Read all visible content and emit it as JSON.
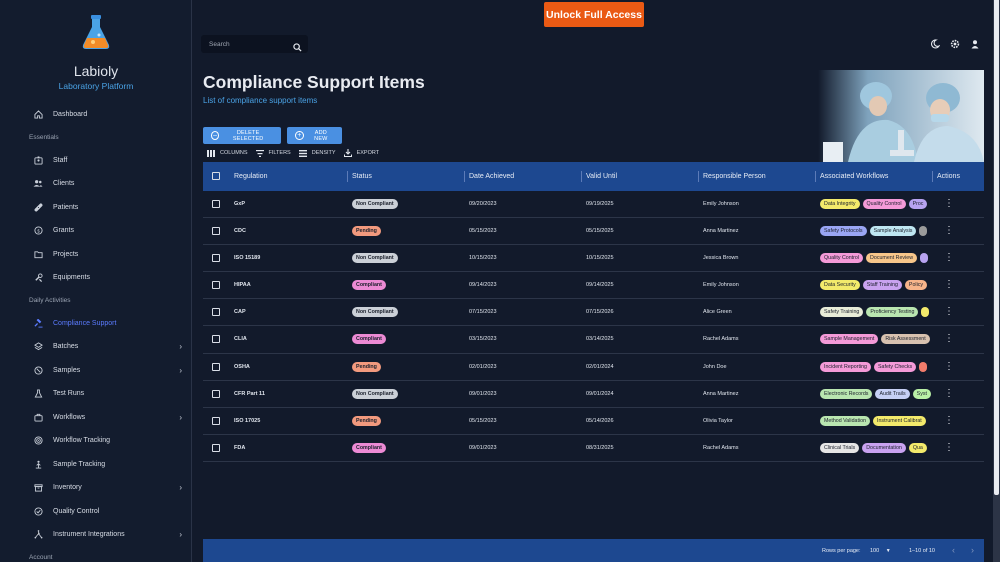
{
  "sidebar": {
    "brand_name": "Labioly",
    "brand_sub": "Laboratory Platform",
    "items": [
      {
        "type": "item",
        "label": "Dashboard",
        "icon": "home-icon"
      },
      {
        "type": "section",
        "label": "Essentials"
      },
      {
        "type": "item",
        "label": "Staff",
        "icon": "badge-icon"
      },
      {
        "type": "item",
        "label": "Clients",
        "icon": "users-icon"
      },
      {
        "type": "item",
        "label": "Patients",
        "icon": "bandage-icon"
      },
      {
        "type": "item",
        "label": "Grants",
        "icon": "coin-icon"
      },
      {
        "type": "item",
        "label": "Projects",
        "icon": "folder-icon"
      },
      {
        "type": "item",
        "label": "Equipments",
        "icon": "tools-icon"
      },
      {
        "type": "section",
        "label": "Daily Activities"
      },
      {
        "type": "item",
        "label": "Compliance Support",
        "icon": "gavel-icon",
        "active": true
      },
      {
        "type": "item",
        "label": "Batches",
        "icon": "layers-icon",
        "chevron": true
      },
      {
        "type": "item",
        "label": "Samples",
        "icon": "vial-icon",
        "chevron": true
      },
      {
        "type": "item",
        "label": "Test Runs",
        "icon": "flask-icon"
      },
      {
        "type": "item",
        "label": "Workflows",
        "icon": "briefcase-icon",
        "chevron": true
      },
      {
        "type": "item",
        "label": "Workflow Tracking",
        "icon": "target-icon"
      },
      {
        "type": "item",
        "label": "Sample Tracking",
        "icon": "tracking-icon"
      },
      {
        "type": "item",
        "label": "Inventory",
        "icon": "inventory-icon",
        "chevron": true
      },
      {
        "type": "item",
        "label": "Quality Control",
        "icon": "check-circle-icon"
      },
      {
        "type": "item",
        "label": "Instrument Integrations",
        "icon": "hub-icon",
        "chevron": true
      },
      {
        "type": "section",
        "label": "Account"
      }
    ]
  },
  "topbar": {
    "unlock_label": "Unlock Full Access",
    "search_placeholder": "Search"
  },
  "page": {
    "title": "Compliance Support Items",
    "subtitle": "List of compliance support items"
  },
  "toolbar": {
    "delete_label": "DELETE SELECTED",
    "add_label": "ADD NEW",
    "columns_label": "COLUMNS",
    "filters_label": "FILTERS",
    "density_label": "DENSITY",
    "export_label": "EXPORT"
  },
  "table": {
    "headers": {
      "regulation": "Regulation",
      "status": "Status",
      "date": "Date Achieved",
      "valid": "Valid Until",
      "person": "Responsible Person",
      "workflows": "Associated Workflows",
      "actions": "Actions"
    },
    "rows": [
      {
        "regulation": "GxP",
        "status": "Non Compliant",
        "status_kind": "non",
        "date": "09/20/2023",
        "valid": "09/19/2025",
        "person": "Emily Johnson",
        "workflows": [
          {
            "label": "Data Integrity",
            "color": "#f3ea6b"
          },
          {
            "label": "Quality Control",
            "color": "#f49ad8"
          },
          {
            "label": "Proc",
            "color": "#b7a3f0"
          }
        ]
      },
      {
        "regulation": "CDC",
        "status": "Pending",
        "status_kind": "pend",
        "date": "05/15/2023",
        "valid": "05/15/2025",
        "person": "Anna Martinez",
        "workflows": [
          {
            "label": "Safety Protocols",
            "color": "#9aa6f4"
          },
          {
            "label": "Sample Analysis",
            "color": "#bfe7f2"
          },
          {
            "label": "",
            "color": "#9b9b9b"
          }
        ]
      },
      {
        "regulation": "ISO 15189",
        "status": "Non Compliant",
        "status_kind": "non",
        "date": "10/15/2023",
        "valid": "10/15/2025",
        "person": "Jessica Brown",
        "workflows": [
          {
            "label": "Quality Control",
            "color": "#f49ad8"
          },
          {
            "label": "Document Review",
            "color": "#f7c68a"
          },
          {
            "label": "",
            "color": "#b7a3f0"
          }
        ]
      },
      {
        "regulation": "HIPAA",
        "status": "Compliant",
        "status_kind": "comp",
        "date": "09/14/2023",
        "valid": "09/14/2025",
        "person": "Emily Johnson",
        "workflows": [
          {
            "label": "Data Security",
            "color": "#f3ea6b"
          },
          {
            "label": "Staff Training",
            "color": "#c9a2f0"
          },
          {
            "label": "Policy",
            "color": "#f7b48a"
          }
        ]
      },
      {
        "regulation": "CAP",
        "status": "Non Compliant",
        "status_kind": "non",
        "date": "07/15/2023",
        "valid": "07/15/2026",
        "person": "Alice Green",
        "workflows": [
          {
            "label": "Safety Training",
            "color": "#e8ecd8"
          },
          {
            "label": "Proficiency Testing",
            "color": "#b9e6b0"
          },
          {
            "label": "",
            "color": "#f3ea6b"
          }
        ]
      },
      {
        "regulation": "CLIA",
        "status": "Compliant",
        "status_kind": "comp",
        "date": "03/15/2023",
        "valid": "03/14/2025",
        "person": "Rachel Adams",
        "workflows": [
          {
            "label": "Sample Management",
            "color": "#f49ad8"
          },
          {
            "label": "Risk Assessment",
            "color": "#d8c2b0"
          }
        ]
      },
      {
        "regulation": "OSHA",
        "status": "Pending",
        "status_kind": "pend",
        "date": "02/01/2023",
        "valid": "02/01/2024",
        "person": "John Doe",
        "workflows": [
          {
            "label": "Incident Reporting",
            "color": "#f49ad8"
          },
          {
            "label": "Safety Checks",
            "color": "#f49ad8"
          },
          {
            "label": "",
            "color": "#f27c6b"
          }
        ]
      },
      {
        "regulation": "CFR Part 11",
        "status": "Non Compliant",
        "status_kind": "non",
        "date": "09/01/2023",
        "valid": "09/01/2024",
        "person": "Anna Martinez",
        "workflows": [
          {
            "label": "Electronic Records",
            "color": "#b9e6b0"
          },
          {
            "label": "Audit Trails",
            "color": "#c6d0f5"
          },
          {
            "label": "Syst",
            "color": "#b9f0a6"
          }
        ]
      },
      {
        "regulation": "ISO 17025",
        "status": "Pending",
        "status_kind": "pend",
        "date": "05/15/2023",
        "valid": "05/14/2026",
        "person": "Olivia Taylor",
        "workflows": [
          {
            "label": "Method Validation",
            "color": "#b9e6b0"
          },
          {
            "label": "Instrument Calibrat",
            "color": "#f3ea6b"
          }
        ]
      },
      {
        "regulation": "FDA",
        "status": "Compliant",
        "status_kind": "comp",
        "date": "09/01/2023",
        "valid": "08/31/2025",
        "person": "Rachel Adams",
        "workflows": [
          {
            "label": "Clinical Trials",
            "color": "#e6e6e6"
          },
          {
            "label": "Documentation",
            "color": "#c9a2f0"
          },
          {
            "label": "Qua",
            "color": "#f3ea6b"
          }
        ]
      }
    ]
  },
  "footer": {
    "rows_per_page_label": "Rows per page:",
    "rows_per_page_value": "100",
    "range": "1–10 of 10"
  }
}
